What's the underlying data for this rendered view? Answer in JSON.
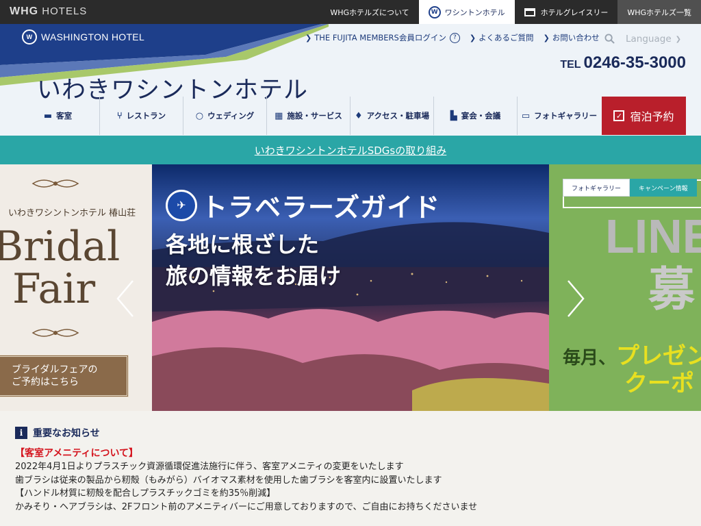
{
  "topbar": {
    "logo_brand": "WHG",
    "logo_text": "HOTELS",
    "tabs": [
      {
        "label": "WHGホテルズについて"
      },
      {
        "label": "ワシントンホテル"
      },
      {
        "label": "ホテルグレイスリー"
      },
      {
        "label": "WHGホテルズ一覧"
      }
    ]
  },
  "header": {
    "brand_logo": "WASHINGTON HOTEL",
    "util_links": [
      {
        "label": "THE FUJITA MEMBERS会員ログイン"
      },
      {
        "label": "よくあるご質問"
      },
      {
        "label": "お問い合わせ"
      }
    ],
    "language": "Language",
    "tel_label": "TEL",
    "tel_number": "0246-35-3000",
    "hotel_name": "いわきワシントンホテル"
  },
  "nav": {
    "items": [
      {
        "label": "客室",
        "icon": "bed-icon"
      },
      {
        "label": "レストラン",
        "icon": "fork-knife-icon"
      },
      {
        "label": "ウェディング",
        "icon": "ring-icon"
      },
      {
        "label": "施設・サービス",
        "icon": "building-icon"
      },
      {
        "label": "アクセス・駐車場",
        "icon": "map-pin-icon"
      },
      {
        "label": "宴会・会議",
        "icon": "podium-icon"
      },
      {
        "label": "フォトギャラリー",
        "icon": "monitor-icon"
      }
    ],
    "reserve_label": "宿泊予約"
  },
  "sdgs": {
    "link": "いわきワシントンホテルSDGsの取り組み"
  },
  "carousel": {
    "left": {
      "hotel_name": "いわきワシントンホテル 椿山荘",
      "bridal_line1": "Bridal",
      "bridal_line2": "Fair",
      "button_line1": "ブライダルフェアの",
      "button_line2": "ご予約はこちら"
    },
    "main": {
      "brand": "トラベラーズガイド",
      "line1": "各地に根ざした",
      "line2": "旅の情報をお届け"
    },
    "right": {
      "big1": "LINE",
      "big2": "募",
      "line3_prefix": "毎月、",
      "line3_highlight": "プレゼン",
      "line4": "クーポ"
    },
    "tabs": [
      {
        "label": "フォトギャラリー"
      },
      {
        "label": "キャンペーン情報"
      }
    ]
  },
  "notice": {
    "title": "重要なお知らせ",
    "subtitle": "【客室アメニティについて】",
    "lines": [
      "2022年4月1日よりプラスチック資源循環促進法施行に伴う、客室アメニティの変更をいたします",
      "歯ブラシは従来の製品から籾殻（もみがら）バイオマス素材を使用した歯ブラシを客室内に設置いたします",
      "【ハンドル材質に籾殻を配合しプラスチックゴミを約35％削減】",
      "かみそり・ヘアブラシは、2Fフロント前のアメニティバーにご用意しておりますので、ご自由にお持ちくださいませ"
    ]
  },
  "colors": {
    "navy": "#1a2a5a",
    "teal": "#2aa6a6",
    "reserve_red": "#b91f2b",
    "notice_red": "#d4141e"
  }
}
